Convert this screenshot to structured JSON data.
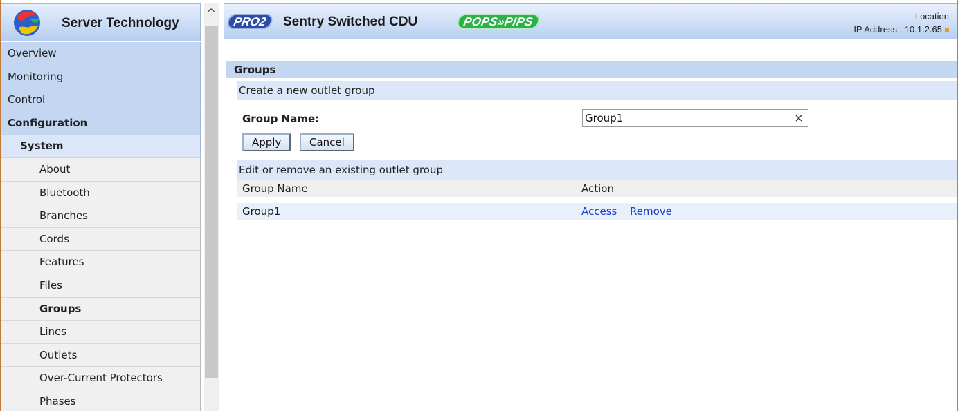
{
  "brand": {
    "company_name": "Server Technology"
  },
  "header": {
    "pro_badge": "PRO2",
    "product_title": "Sentry Switched CDU",
    "pops_badge": "POPS»PIPS",
    "location_label": "Location",
    "ip_address": "IP Address : 10.1.2.65"
  },
  "nav": {
    "scroll_up_glyph": "^",
    "top_items": [
      {
        "label": "Overview"
      },
      {
        "label": "Monitoring"
      },
      {
        "label": "Control"
      },
      {
        "label": "Configuration"
      }
    ],
    "section": "System",
    "sub_items": [
      {
        "label": "About"
      },
      {
        "label": "Bluetooth"
      },
      {
        "label": "Branches"
      },
      {
        "label": "Cords"
      },
      {
        "label": "Features"
      },
      {
        "label": "Files"
      },
      {
        "label": "Groups"
      },
      {
        "label": "Lines"
      },
      {
        "label": "Outlets"
      },
      {
        "label": "Over-Current Protectors"
      },
      {
        "label": "Phases"
      }
    ],
    "active_item": "Groups"
  },
  "main": {
    "section_title": "Groups",
    "create": {
      "header": "Create a new outlet group",
      "field_label": "Group Name:",
      "field_value": "Group1",
      "clear_glyph": "×",
      "apply_label": "Apply",
      "cancel_label": "Cancel"
    },
    "edit": {
      "header": "Edit or remove an existing outlet group",
      "columns": [
        "Group Name",
        "Action"
      ],
      "rows": [
        {
          "name": "Group1",
          "actions": [
            "Access",
            "Remove"
          ]
        }
      ]
    }
  },
  "colors": {
    "nav_blue": "#c3d7f3",
    "nav_light_blue": "#dbe7f8",
    "link_blue": "#1a3fcf",
    "pro_badge": "#2a4ea8",
    "pops_badge": "#2bb34a"
  }
}
